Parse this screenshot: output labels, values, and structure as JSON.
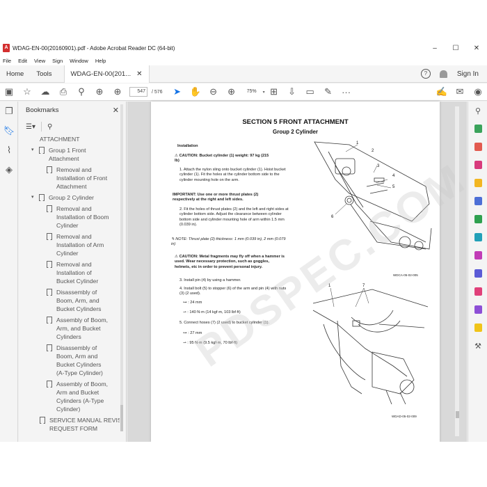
{
  "window": {
    "title": "WDAG-EN-00(20160901).pdf - Adobe Acrobat Reader DC (64-bit)",
    "app_icon": "pdf-app-icon",
    "controls": [
      "–",
      "☐",
      "✕"
    ]
  },
  "menu": [
    "File",
    "Edit",
    "View",
    "Sign",
    "Window",
    "Help"
  ],
  "tabs": {
    "home": "Home",
    "tools": "Tools",
    "document": "WDAG-EN-00(201...",
    "signin": "Sign In"
  },
  "toolbar": {
    "current_page": "547",
    "total_pages": "/ 576",
    "zoom": "75%"
  },
  "bookmarks": {
    "header": "Bookmarks",
    "items": [
      {
        "label": "ATTACHMENT",
        "level": 0,
        "arrow": ""
      },
      {
        "label": "Group 1 Front Attachment",
        "level": 1,
        "arrow": "▾"
      },
      {
        "label": "Removal and Installation of Front Attachment",
        "level": 2,
        "arrow": ""
      },
      {
        "label": "Group 2 Cylinder",
        "level": 1,
        "arrow": "▾"
      },
      {
        "label": "Removal and Installation of Boom Cylinder",
        "level": 2,
        "arrow": ""
      },
      {
        "label": "Removal and Installation of Arm Cylinder",
        "level": 2,
        "arrow": ""
      },
      {
        "label": "Removal and Installation of Bucket Cylinder",
        "level": 2,
        "arrow": ""
      },
      {
        "label": "Disassembly of Boom, Arm, and Bucket Cylinders",
        "level": 2,
        "arrow": ""
      },
      {
        "label": "Assembly of Boom, Arm, and Bucket Cylinders",
        "level": 2,
        "arrow": ""
      },
      {
        "label": "Disassembly of Boom, Arm and Bucket Cylinders (A-Type Cylinder)",
        "level": 2,
        "arrow": ""
      },
      {
        "label": "Assembly of Boom, Arm and Bucket Cylinders (A-Type Cylinder)",
        "level": 2,
        "arrow": ""
      },
      {
        "label": "SERVICE MANUAL REVISION REQUEST FORM",
        "level": 0,
        "arrow": ""
      }
    ]
  },
  "page": {
    "section_title": "SECTION 5 FRONT ATTACHMENT",
    "group_title": "Group 2 Cylinder",
    "installation": "Installation",
    "caution1_label": "CAUTION:",
    "caution1_text": "Bucket cylinder (1) weight: 97 kg (215 lb)",
    "step1": "1.  Attach the nylon sling onto bucket cylinder (1). Hoist bucket cylinder (1). Fit the holes at the cylinder bottom side to the cylinder mounting hole on the arm.",
    "important_label": "IMPORTANT:",
    "important_text": "Use one or more thrust plates (2) respectively at the right and left sides.",
    "step2": "2.  Fit the holes of thrust plates (2) and the left and right sides at cylinder bottom side. Adjust the clearance between cylinder bottom side and cylinder mounting hole of arm within 1.5 mm (0.039 in).",
    "note_label": "NOTE:",
    "note_text": "Thrust plate (2) thickness: 1 mm (0.039 in), 2 mm (0.079 in)",
    "caution2_label": "CAUTION:",
    "caution2_text": "Metal fragments may fly off when a hammer is used. Wear necessary protection, such as goggles, helmets, etc in order to prevent personal injury.",
    "step3": "3.  Install pin (4) by using a hammer.",
    "step4": "4.  Install bolt (5) to stopper (6) of the arm and pin (4) with nuts (3) (2 used).",
    "spec1": ": 24 mm",
    "spec2": ": 140 N·m (14 kgf·m, 103 lbf·ft)",
    "step5": "5.  Connect hoses (7) (2 used) to bucket cylinder (1).",
    "spec3": ": 27 mm",
    "spec4": ": 95 N·m (9.5 kgf·m, 70 lbf·ft)",
    "fig1_caption": "WDCA-05-02-005",
    "fig2_caption": "WDAD-05-02-009",
    "callouts_fig1": [
      "1",
      "2",
      "3",
      "4",
      "5",
      "6"
    ],
    "callouts_fig2": [
      "1",
      "7"
    ],
    "watermark": "PDSPEC.COM"
  }
}
